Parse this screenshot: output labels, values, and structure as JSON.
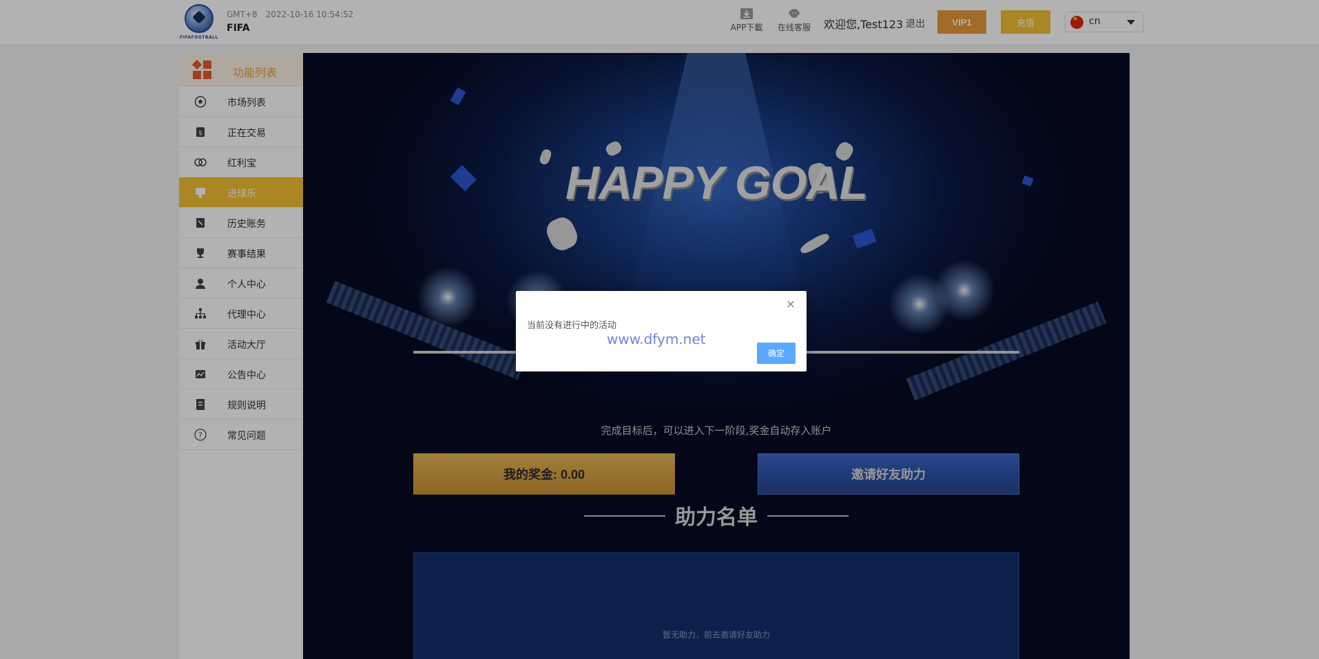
{
  "header": {
    "logo_text": "FIFAFOOTBALL",
    "timezone": "GMT+8",
    "datetime": "2022-10-16 10:54:52",
    "site_name": "FIFA",
    "app_download": "APP下載",
    "online_service": "在线客服",
    "welcome": "欢迎您,Test123",
    "logout": "退出",
    "vip": "VIP1",
    "recharge": "充值",
    "language": "cn"
  },
  "sidebar": {
    "title": "功能列表",
    "items": [
      {
        "label": "市场列表",
        "icon": "soccer-ball-icon"
      },
      {
        "label": "正在交易",
        "icon": "money-card-icon"
      },
      {
        "label": "红利宝",
        "icon": "coins-icon"
      },
      {
        "label": "进球乐",
        "icon": "goal-board-icon",
        "active": true
      },
      {
        "label": "历史账务",
        "icon": "ledger-icon"
      },
      {
        "label": "赛事结果",
        "icon": "trophy-icon"
      },
      {
        "label": "个人中心",
        "icon": "user-icon"
      },
      {
        "label": "代理中心",
        "icon": "hierarchy-icon"
      },
      {
        "label": "活动大厅",
        "icon": "gift-icon"
      },
      {
        "label": "公告中心",
        "icon": "notice-icon"
      },
      {
        "label": "规则说明",
        "icon": "rules-book-icon"
      },
      {
        "label": "常见问题",
        "icon": "question-icon"
      }
    ]
  },
  "main": {
    "banner_title": "HAPPY GOAL",
    "hint": "完成目标后，可以进入下一阶段,奖金自动存入账户",
    "bonus_button": "我的奖金: 0.00",
    "invite_button": "邀请好友助力",
    "list_title": "助力名单",
    "list_empty": "暂无助力，前去邀请好友助力"
  },
  "modal": {
    "message": "当前没有进行中的活动",
    "ok": "确定",
    "close_symbol": "✕"
  },
  "watermark": "www.dfym.net",
  "colors": {
    "accent_gold": "#f4c234",
    "vip_orange": "#e89a3a",
    "modal_button": "#5aa8ff",
    "sidebar_title": "#e6a23c"
  }
}
